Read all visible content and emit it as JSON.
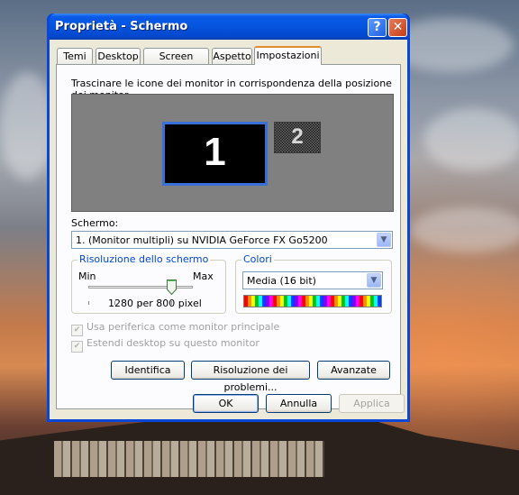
{
  "window": {
    "title": "Proprietà - Schermo",
    "help_label": "?",
    "close_label": "✕"
  },
  "tabs": [
    {
      "label": "Temi"
    },
    {
      "label": "Desktop"
    },
    {
      "label": "Screen saver"
    },
    {
      "label": "Aspetto"
    },
    {
      "label": "Impostazioni",
      "active": true
    }
  ],
  "settings": {
    "instruction": "Trascinare le icone dei monitor in corrispondenza della posizione dei monitor.",
    "monitors": [
      {
        "number": "1"
      },
      {
        "number": "2"
      }
    ],
    "screen_label": "Schermo:",
    "screen_value": "1. (Monitor multipli) su NVIDIA GeForce FX Go5200",
    "resolution": {
      "legend": "Risoluzione dello schermo",
      "min_label": "Min",
      "max_label": "Max",
      "value_text": "1280 per 800 pixel"
    },
    "colors": {
      "legend": "Colori",
      "value": "Media (16 bit)"
    },
    "primary_monitor_checkbox": "Usa periferica come monitor principale",
    "extend_desktop_checkbox": "Estendi desktop su questo monitor",
    "identify_button": "Identifica",
    "troubleshoot_button": "Risoluzione dei problemi...",
    "advanced_button": "Avanzate"
  },
  "footer": {
    "ok": "OK",
    "cancel": "Annulla",
    "apply": "Applica"
  }
}
